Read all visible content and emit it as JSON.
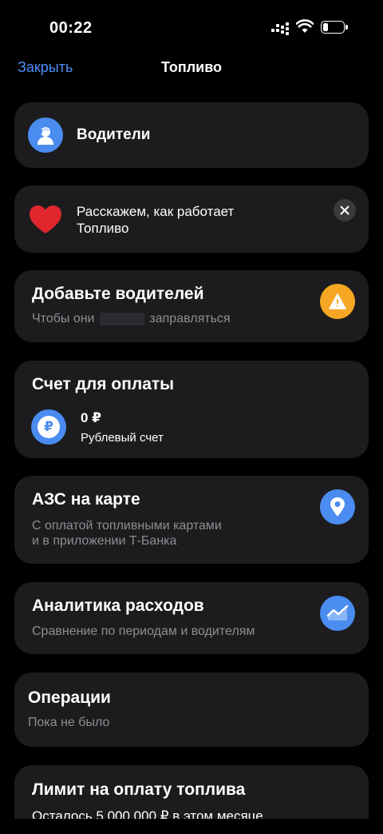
{
  "status_bar": {
    "time": "00:22"
  },
  "nav": {
    "close_label": "Закрыть",
    "title": "Топливо"
  },
  "drivers_card": {
    "label": "Водители"
  },
  "promo_card": {
    "line1": "Расскажем, как работает",
    "line2": "Топливо"
  },
  "add_drivers_card": {
    "title": "Добавьте водителей",
    "sub_before": "Чтобы они",
    "sub_after": "заправляться"
  },
  "account_card": {
    "title": "Счет для оплаты",
    "amount": "0 ₽",
    "account_name": "Рублевый счет",
    "currency_symbol": "₽"
  },
  "stations_card": {
    "title": "АЗС на карте",
    "line1": "С оплатой топливными картами",
    "line2": "и в приложении Т-Банка"
  },
  "analytics_card": {
    "title": "Аналитика расходов",
    "sub": "Сравнение по периодам и водителям"
  },
  "operations_card": {
    "title": "Операции",
    "sub": "Пока не было"
  },
  "limit_card": {
    "title": "Лимит на оплату топлива",
    "sub": "Осталось 5 000 000 ₽ в этом месяце"
  },
  "colors": {
    "accent": "#4a8cf0",
    "warning": "#f5a623",
    "card_bg": "#1c1c1e",
    "link": "#4c8ef7"
  },
  "icons": [
    "driver-icon",
    "heart-icon",
    "close-icon",
    "warning-icon",
    "ruble-icon",
    "location-pin-icon",
    "trend-chart-icon"
  ]
}
